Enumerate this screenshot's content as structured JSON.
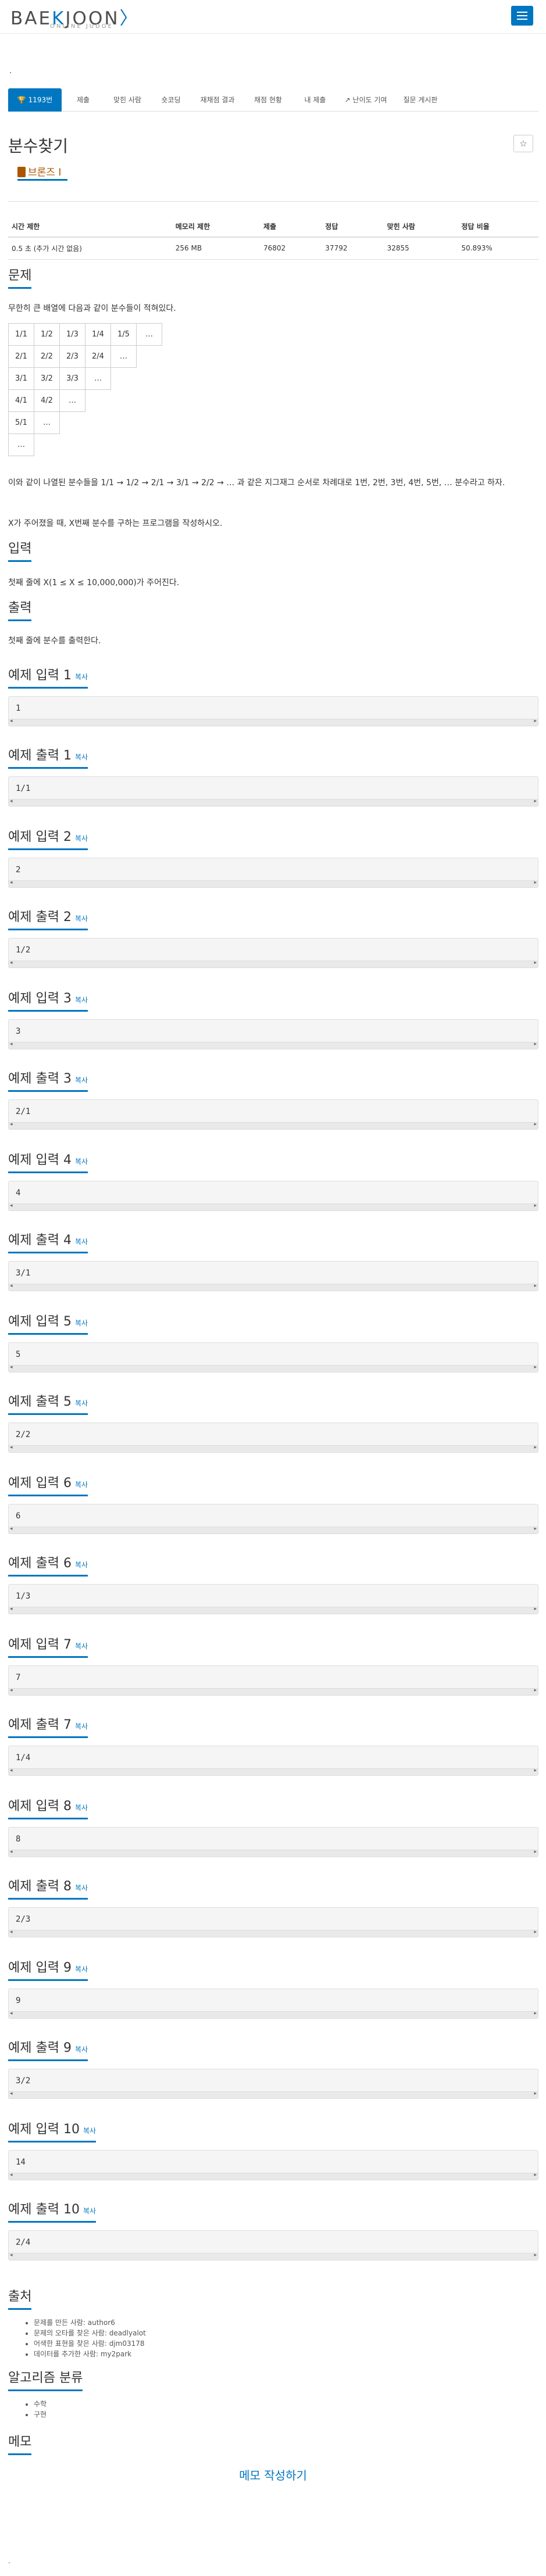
{
  "brand": {
    "logo_left": "BAE",
    "logo_mid": "K",
    "logo_right": "JOON",
    "logo_arrow": "〉",
    "tagline": "ONLINE JUDGE"
  },
  "dot": ".",
  "tabs": [
    {
      "label": "1193번",
      "active": true,
      "icon": "trophy-icon"
    },
    {
      "label": "제출"
    },
    {
      "label": "맞힌 사람"
    },
    {
      "label": "숏코딩"
    },
    {
      "label": "재채점 결과"
    },
    {
      "label": "채점 현황"
    },
    {
      "label": "내 제출"
    },
    {
      "label": "난이도 기여",
      "icon": "external-link-icon"
    },
    {
      "label": "질문 게시판"
    }
  ],
  "problem": {
    "title": "분수찾기",
    "star": "☆",
    "tier": "브론즈 I",
    "info_headers": [
      "시간 제한",
      "메모리 제한",
      "제출",
      "정답",
      "맞힌 사람",
      "정답 비율"
    ],
    "info_values": [
      "0.5 초 (추가 시간 없음)",
      "256 MB",
      "76802",
      "37792",
      "32855",
      "50.893%"
    ]
  },
  "sections": {
    "desc_title": "문제",
    "desc_text": "무한히 큰 배열에 다음과 같이 분수들이 적혀있다.",
    "grid": [
      [
        "1/1",
        "1/2",
        "1/3",
        "1/4",
        "1/5",
        "…"
      ],
      [
        "2/1",
        "2/2",
        "2/3",
        "2/4",
        "…",
        ""
      ],
      [
        "3/1",
        "3/2",
        "3/3",
        "…",
        "",
        ""
      ],
      [
        "4/1",
        "4/2",
        "…",
        "",
        "",
        ""
      ],
      [
        "5/1",
        "…",
        "",
        "",
        "",
        ""
      ],
      [
        "…",
        "",
        "",
        "",
        "",
        ""
      ]
    ],
    "desc_text2": "이와 같이 나열된 분수들을 1/1 → 1/2 → 2/1 → 3/1 → 2/2 → … 과 같은 지그재그 순서로 차례대로 1번, 2번, 3번, 4번, 5번, … 분수라고 하자.",
    "desc_text3": "X가 주어졌을 때, X번째 분수를 구하는 프로그램을 작성하시오.",
    "input_title": "입력",
    "input_text": "첫째 줄에 X(1 ≤ X ≤ 10,000,000)가 주어진다.",
    "output_title": "출력",
    "output_text": "첫째 줄에 분수를 출력한다.",
    "copy": "복사"
  },
  "examples": [
    {
      "in_title": "예제 입력 1",
      "in": "1",
      "out_title": "예제 출력 1",
      "out": "1/1"
    },
    {
      "in_title": "예제 입력 2",
      "in": "2",
      "out_title": "예제 출력 2",
      "out": "1/2"
    },
    {
      "in_title": "예제 입력 3",
      "in": "3",
      "out_title": "예제 출력 3",
      "out": "2/1"
    },
    {
      "in_title": "예제 입력 4",
      "in": "4",
      "out_title": "예제 출력 4",
      "out": "3/1"
    },
    {
      "in_title": "예제 입력 5",
      "in": "5",
      "out_title": "예제 출력 5",
      "out": "2/2"
    },
    {
      "in_title": "예제 입력 6",
      "in": "6",
      "out_title": "예제 출력 6",
      "out": "1/3"
    },
    {
      "in_title": "예제 입력 7",
      "in": "7",
      "out_title": "예제 출력 7",
      "out": "1/4"
    },
    {
      "in_title": "예제 입력 8",
      "in": "8",
      "out_title": "예제 출력 8",
      "out": "2/3"
    },
    {
      "in_title": "예제 입력 9",
      "in": "9",
      "out_title": "예제 출력 9",
      "out": "3/2"
    },
    {
      "in_title": "예제 입력 10",
      "in": "14",
      "out_title": "예제 출력 10",
      "out": "2/4"
    }
  ],
  "source": {
    "title": "출처",
    "items": [
      "문제를 만든 사람: author6",
      "문제의 오타를 찾은 사람: deadlyalot",
      "어색한 표현을 찾은 사람: djm03178",
      "데이터를 추가한 사람: my2park"
    ]
  },
  "algo": {
    "title": "알고리즘 분류",
    "items": [
      "수학",
      "구현"
    ]
  },
  "memo": {
    "title": "메모",
    "write": "메모 작성하기"
  },
  "footer_dot": "."
}
